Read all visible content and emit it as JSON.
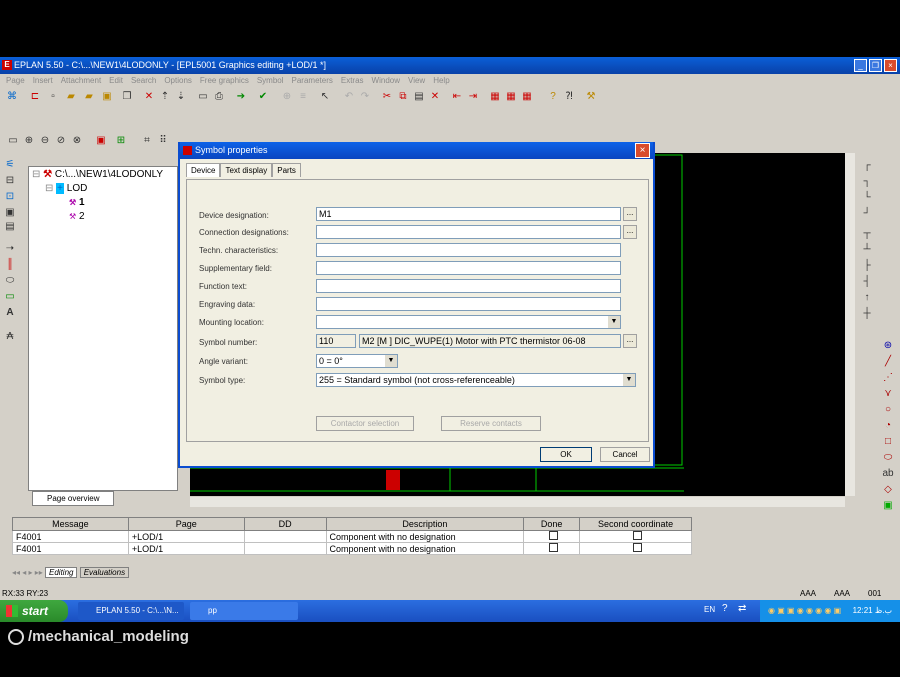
{
  "window": {
    "title": "EPLAN 5.50 - C:\\...\\NEW1\\4LODONLY - [EPL5001 Graphics editing +LOD/1  *]"
  },
  "menu": [
    "Page",
    "Insert",
    "Attachment",
    "Edit",
    "Search",
    "Options",
    "Free graphics",
    "Symbol",
    "Parameters",
    "Extras",
    "Window",
    "View",
    "Help"
  ],
  "tree": {
    "root": "C:\\...\\NEW1\\4LODONLY",
    "node": "LOD",
    "pages": [
      "1",
      "2"
    ],
    "tab": "Page overview"
  },
  "dialog": {
    "title": "Symbol properties",
    "tabs": [
      "Device",
      "Text display",
      "Parts"
    ],
    "fields": {
      "device_designation": {
        "label": "Device designation:",
        "value": "M1"
      },
      "connection_designations": {
        "label": "Connection designations:",
        "value": ""
      },
      "techn_characteristics": {
        "label": "Techn. characteristics:",
        "value": ""
      },
      "supplementary_field": {
        "label": "Supplementary field:",
        "value": ""
      },
      "function_text": {
        "label": "Function text:",
        "value": ""
      },
      "engraving_data": {
        "label": "Engraving data:",
        "value": ""
      },
      "mounting_location": {
        "label": "Mounting location:",
        "value": ""
      },
      "symbol_number": {
        "label": "Symbol number:",
        "value": "110",
        "desc": "M2 [M ] DIC_WUPE(1) Motor with PTC thermistor 06-08"
      },
      "angle_variant": {
        "label": "Angle variant:",
        "value": "0 = 0°"
      },
      "symbol_type": {
        "label": "Symbol type:",
        "value": "255 = Standard symbol (not cross-referenceable)"
      }
    },
    "buttons": {
      "contactor": "Contactor selection",
      "reserve": "Reserve contacts",
      "ok": "OK",
      "cancel": "Cancel"
    },
    "dots": "..."
  },
  "messages": {
    "headers": [
      "Message",
      "Page",
      "DD",
      "Description",
      "Done",
      "Second coordinate"
    ],
    "rows": [
      {
        "message": "F4001",
        "page": "+LOD/1",
        "dd": "",
        "description": "Component with no designation"
      },
      {
        "message": "F4001",
        "page": "+LOD/1",
        "dd": "",
        "description": "Component with no designation"
      }
    ],
    "tabs": [
      "Editing",
      "Evaluations"
    ]
  },
  "status": {
    "coords": "RX:33 RY:23",
    "f1": "AAA",
    "f2": "AAA",
    "f3": "001"
  },
  "taskbar": {
    "start": "start",
    "tasks": [
      "EPLAN 5.50 - C:\\...\\N...",
      "pp"
    ],
    "lang": "EN",
    "time": "12:21 ب.ظ"
  },
  "caption": "/mechanical_modeling"
}
